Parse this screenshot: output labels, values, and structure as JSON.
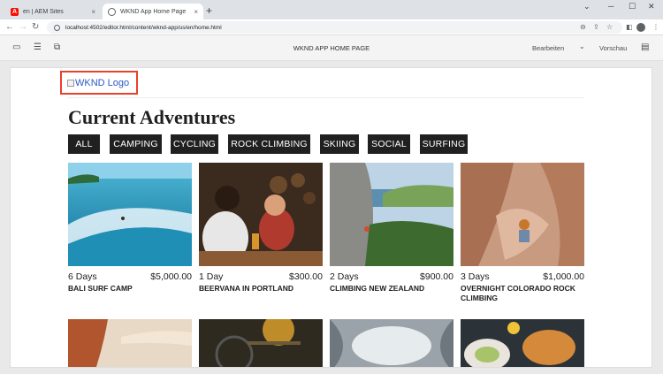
{
  "browser": {
    "tabs": [
      {
        "title": "en | AEM Sites",
        "close": "×"
      },
      {
        "title": "WKND App Home Page",
        "close": "×"
      }
    ],
    "new_tab": "+",
    "url": "localhost:4502/editor.html/content/wknd-app/us/en/home.html",
    "icons": [
      "back-arrow-icon",
      "forward-arrow-icon",
      "reload-icon",
      "zoom-icon",
      "share-icon",
      "star-icon",
      "side-panel-icon",
      "profile-icon",
      "menu-icon"
    ]
  },
  "editor": {
    "page_title": "WKND APP HOME PAGE",
    "mode": "Bearbeiten",
    "preview": "Vorschau"
  },
  "page": {
    "logo_alt": "WKND Logo",
    "heading": "Current Adventures",
    "filters": [
      "ALL",
      "CAMPING",
      "CYCLING",
      "ROCK CLIMBING",
      "SKIING",
      "SOCIAL",
      "SURFING"
    ],
    "adventures": [
      {
        "duration": "6 Days",
        "price": "$5,000.00",
        "name": "BALI SURF CAMP"
      },
      {
        "duration": "1 Day",
        "price": "$300.00",
        "name": "BEERVANA IN PORTLAND"
      },
      {
        "duration": "2 Days",
        "price": "$900.00",
        "name": "CLIMBING NEW ZEALAND"
      },
      {
        "duration": "3 Days",
        "price": "$1,000.00",
        "name": "OVERNIGHT COLORADO ROCK CLIMBING"
      }
    ]
  },
  "colors": {
    "accent_outline": "#e8412c",
    "filter_bg": "#202020",
    "link": "#2b59c3"
  }
}
